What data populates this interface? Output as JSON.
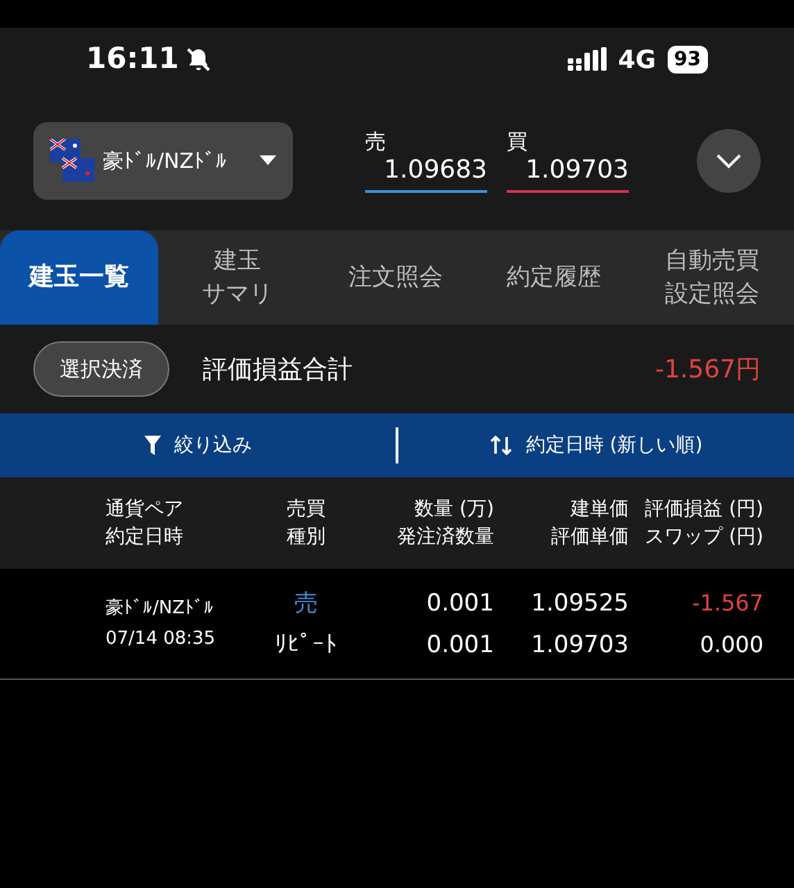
{
  "status_bar": {
    "time": "16:11",
    "network": "4G",
    "battery": "93"
  },
  "quote": {
    "pair": "豪ﾄﾞﾙ/NZﾄﾞﾙ",
    "sell_label": "売",
    "sell": "1.09683",
    "buy_label": "買",
    "buy": "1.09703"
  },
  "tabs": [
    {
      "lines": [
        "建玉一覧"
      ],
      "selected": true
    },
    {
      "lines": [
        "建玉",
        "サマリ"
      ],
      "selected": false
    },
    {
      "lines": [
        "注文照会"
      ],
      "selected": false
    },
    {
      "lines": [
        "約定履歴"
      ],
      "selected": false
    },
    {
      "lines": [
        "自動売買",
        "設定照会"
      ],
      "selected": false
    }
  ],
  "summary": {
    "button": "選択決済",
    "label": "評価損益合計",
    "value": "-1.567円",
    "kind": "loss"
  },
  "toolbar": {
    "filter": "絞り込み",
    "sort": "約定日時 (新しい順)"
  },
  "table": {
    "columns": [
      [
        "通貨ペア",
        "約定日時"
      ],
      [
        "売買",
        "種別"
      ],
      [
        "数量 (万)",
        "発注済数量"
      ],
      [
        "建単価",
        "評価単価"
      ],
      [
        "評価損益 (円)",
        "スワップ (円)"
      ]
    ],
    "rows": [
      {
        "pair": "豪ﾄﾞﾙ/NZﾄﾞﾙ",
        "date": "07/14 08:35",
        "side": {
          "text": "売",
          "kind": "sell"
        },
        "type": "ﾘﾋﾟｰﾄ",
        "qty": "0.001",
        "ordered_qty": "0.001",
        "open_price": "1.09525",
        "eval_price": "1.09703",
        "pl": {
          "text": "-1.567",
          "kind": "loss"
        },
        "swap": "0.000"
      }
    ]
  }
}
